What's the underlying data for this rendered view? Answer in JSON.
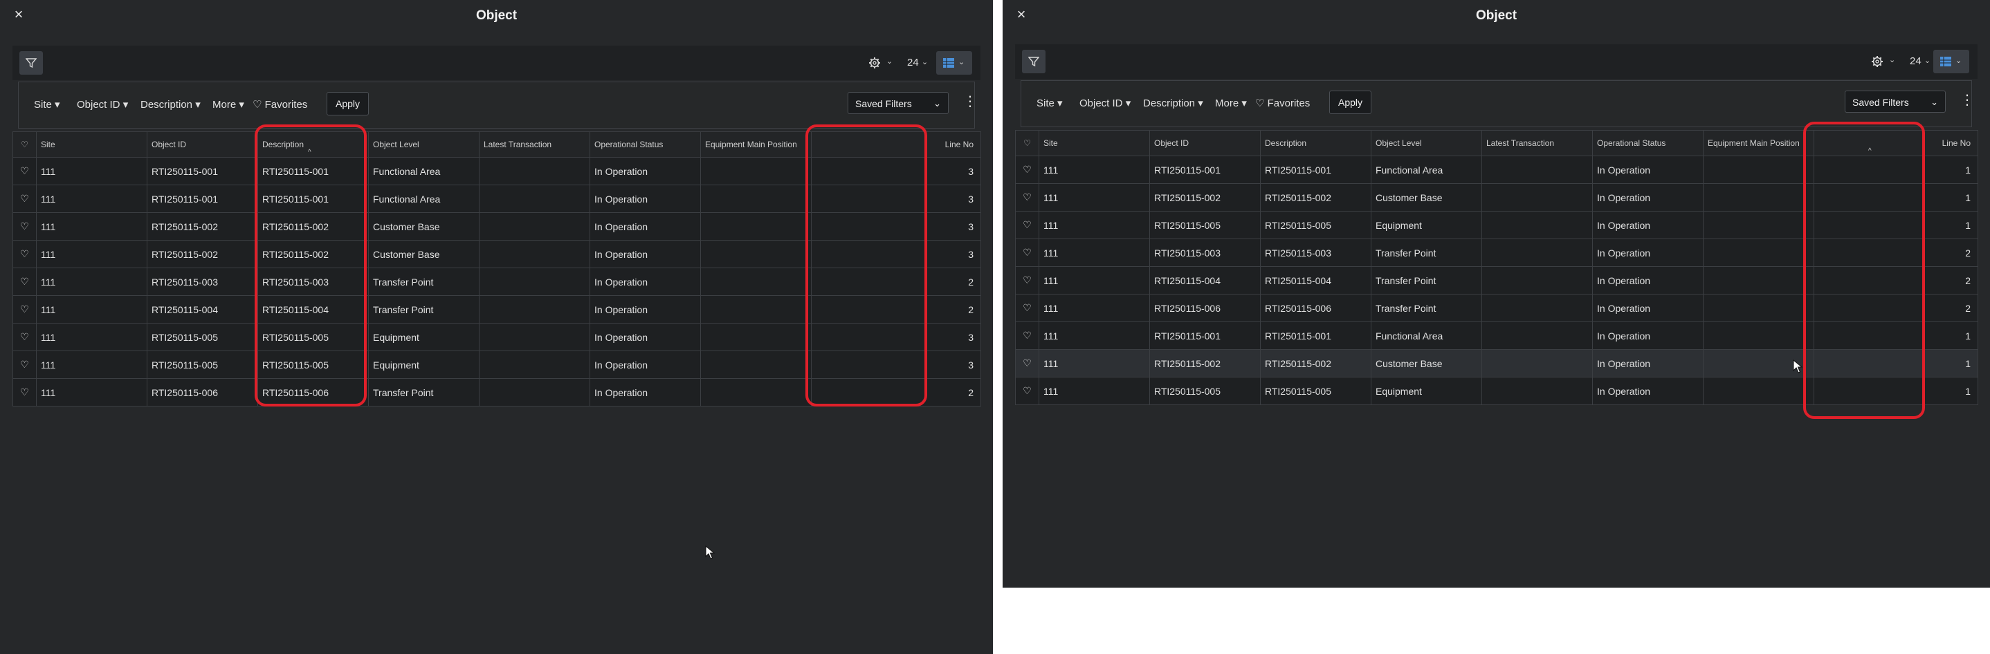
{
  "panels": [
    {
      "id": "left",
      "title": "Object",
      "toolbar": {
        "page_size": "24"
      },
      "filters": {
        "chips": [
          "Site",
          "Object ID",
          "Description",
          "More"
        ],
        "favorites": "Favorites",
        "apply": "Apply",
        "saved_filters": "Saved Filters"
      },
      "columns": [
        "Site",
        "Object ID",
        "Description",
        "Object Level",
        "Latest Transaction",
        "Operational Status",
        "Equipment Main Position",
        "Line No"
      ],
      "sorted_column": "Description",
      "rows": [
        [
          "111",
          "RTI250115-001",
          "RTI250115-001",
          "Functional Area",
          "",
          "In Operation",
          "",
          "3"
        ],
        [
          "111",
          "RTI250115-001",
          "RTI250115-001",
          "Functional Area",
          "",
          "In Operation",
          "",
          "3"
        ],
        [
          "111",
          "RTI250115-002",
          "RTI250115-002",
          "Customer Base",
          "",
          "In Operation",
          "",
          "3"
        ],
        [
          "111",
          "RTI250115-002",
          "RTI250115-002",
          "Customer Base",
          "",
          "In Operation",
          "",
          "3"
        ],
        [
          "111",
          "RTI250115-003",
          "RTI250115-003",
          "Transfer Point",
          "",
          "In Operation",
          "",
          "2"
        ],
        [
          "111",
          "RTI250115-004",
          "RTI250115-004",
          "Transfer Point",
          "",
          "In Operation",
          "",
          "2"
        ],
        [
          "111",
          "RTI250115-005",
          "RTI250115-005",
          "Equipment",
          "",
          "In Operation",
          "",
          "3"
        ],
        [
          "111",
          "RTI250115-005",
          "RTI250115-005",
          "Equipment",
          "",
          "In Operation",
          "",
          "3"
        ],
        [
          "111",
          "RTI250115-006",
          "RTI250115-006",
          "Transfer Point",
          "",
          "In Operation",
          "",
          "2"
        ]
      ]
    },
    {
      "id": "right",
      "title": "Object",
      "toolbar": {
        "page_size": "24"
      },
      "filters": {
        "chips": [
          "Site",
          "Object ID",
          "Description",
          "More"
        ],
        "favorites": "Favorites",
        "apply": "Apply",
        "saved_filters": "Saved Filters"
      },
      "columns": [
        "Site",
        "Object ID",
        "Description",
        "Object Level",
        "Latest Transaction",
        "Operational Status",
        "Equipment Main Position",
        "Line No"
      ],
      "sorted_column": "Line No",
      "rows": [
        [
          "111",
          "RTI250115-001",
          "RTI250115-001",
          "Functional Area",
          "",
          "In Operation",
          "",
          "1"
        ],
        [
          "111",
          "RTI250115-002",
          "RTI250115-002",
          "Customer Base",
          "",
          "In Operation",
          "",
          "1"
        ],
        [
          "111",
          "RTI250115-005",
          "RTI250115-005",
          "Equipment",
          "",
          "In Operation",
          "",
          "1"
        ],
        [
          "111",
          "RTI250115-003",
          "RTI250115-003",
          "Transfer Point",
          "",
          "In Operation",
          "",
          "2"
        ],
        [
          "111",
          "RTI250115-004",
          "RTI250115-004",
          "Transfer Point",
          "",
          "In Operation",
          "",
          "2"
        ],
        [
          "111",
          "RTI250115-006",
          "RTI250115-006",
          "Transfer Point",
          "",
          "In Operation",
          "",
          "2"
        ],
        [
          "111",
          "RTI250115-001",
          "RTI250115-001",
          "Functional Area",
          "",
          "In Operation",
          "",
          "1"
        ],
        [
          "111",
          "RTI250115-002",
          "RTI250115-002",
          "Customer Base",
          "",
          "In Operation",
          "",
          "1"
        ],
        [
          "111",
          "RTI250115-005",
          "RTI250115-005",
          "Equipment",
          "",
          "In Operation",
          "",
          "1"
        ]
      ],
      "hovered_row": 7
    }
  ],
  "colors": {
    "background": "#26282a",
    "grid_cell": "#1e2022",
    "highlight_box": "#e0202a",
    "text": "#e0e0e0"
  }
}
